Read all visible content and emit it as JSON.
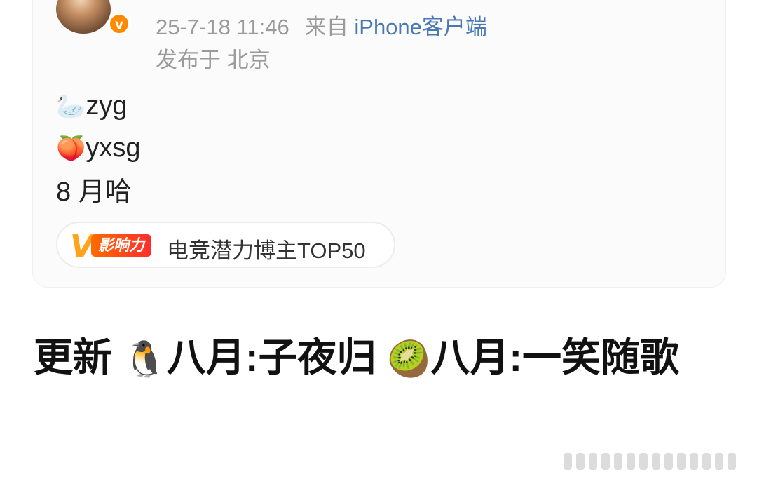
{
  "post": {
    "time": "25-7-18 11:46",
    "source_prefix": "来自",
    "source_client": "iPhone客户端",
    "location": "发布于 北京",
    "verified_badge": "v",
    "lines": [
      {
        "emoji": "🦢",
        "text": "zyg"
      },
      {
        "emoji": "🍑",
        "text": "yxsg"
      },
      {
        "emoji": "",
        "text": "8 月哈"
      }
    ],
    "influence": {
      "logo_letter": "V",
      "logo_label": "影响力",
      "text": "电竞潜力博主TOP50"
    }
  },
  "headline": {
    "prefix": "更新 ",
    "emoji1": "🐧",
    "part1": "八月:子夜归 ",
    "emoji2": "🥝",
    "part2": "八月:一笑随歌"
  },
  "colors": {
    "meta_gray": "#9a9a9a",
    "client_blue": "#4a78b4",
    "badge_orange": "#ff8a00"
  }
}
